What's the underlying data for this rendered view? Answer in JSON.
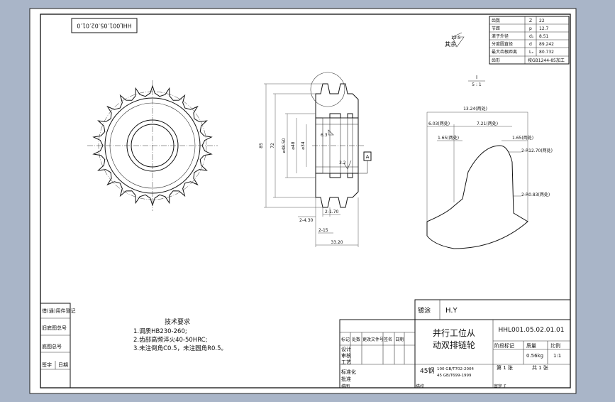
{
  "drawing": {
    "rotated_code": "HHL001.05.02.01.0",
    "roughness_general": "12.5",
    "roughness_rest_label": "其余",
    "scale_note_top": "I",
    "scale_note_bottom": "5 : 1",
    "spec_table": [
      {
        "name": "齿数",
        "symbol": "Z",
        "value": "22"
      },
      {
        "name": "节距",
        "symbol": "p",
        "value": "12.7"
      },
      {
        "name": "滚子外径",
        "symbol": "d₁",
        "value": "8.51"
      },
      {
        "name": "分度圆直径",
        "symbol": "d",
        "value": "89.242"
      },
      {
        "name": "最大齿根距离",
        "symbol": "Lₓ",
        "value": "80.732"
      },
      {
        "name": "齿形",
        "symbol": "",
        "value": "按GB1244-85加工"
      }
    ],
    "section_dims": {
      "total_width": "33.20",
      "d2": "2-15",
      "d3": "2-4.30",
      "d4": "2-1.70",
      "dia_a": "85",
      "dia_b": "72",
      "dia_c": "⌀48.50",
      "dia_d": "⌀48",
      "dia_e": "⌀34",
      "rough_bore": "3.2",
      "rough_face": "6.3",
      "datum": "A"
    },
    "detail_dims": {
      "d_top": "13.24(两处)",
      "d_left": "6.03(两处)",
      "d_mid": "7.21(两处)",
      "d_a": "1.65(两处)",
      "d_b": "1.65(两处)",
      "r1": "2-R12.70(两处)",
      "r2": "2-R0.83(两处)"
    },
    "tech_req": {
      "title": "技术要求",
      "lines": [
        "1.调质HB230-260;",
        "2.齿部高频淬火40-50HRC;",
        "3.未注倒角C0.5，未注圆角R0.5。"
      ]
    },
    "left_strip": [
      "借(通)用件登记",
      "旧底图总号",
      "底图总号",
      "签字",
      "日期"
    ],
    "title_block": {
      "material": "45钢",
      "surface": "镀涂",
      "designer_code": "H.Y",
      "part_name_1": "并行工位从",
      "part_name_2": "动双排链轮",
      "drawing_no": "HHL001.05.02.01.01",
      "stage_label": "阶段标记",
      "weight_label": "质量",
      "scale_label": "比例",
      "weight": "0.56kg",
      "scale": "1:1",
      "sheet_a": "第 1 张",
      "sheet_b": "共 1 张",
      "rev_headers": [
        "标记",
        "处数",
        "更改文件号",
        "签名",
        "日期"
      ],
      "roles": [
        "设计",
        "审核",
        "工艺"
      ],
      "std_label": "标准化",
      "approve_label": "批准",
      "std1": "100 GB/T702-2004",
      "std2": "45 GB/T699-1999",
      "bottom": [
        "描图",
        "描校",
        "审定 Σ"
      ]
    }
  }
}
